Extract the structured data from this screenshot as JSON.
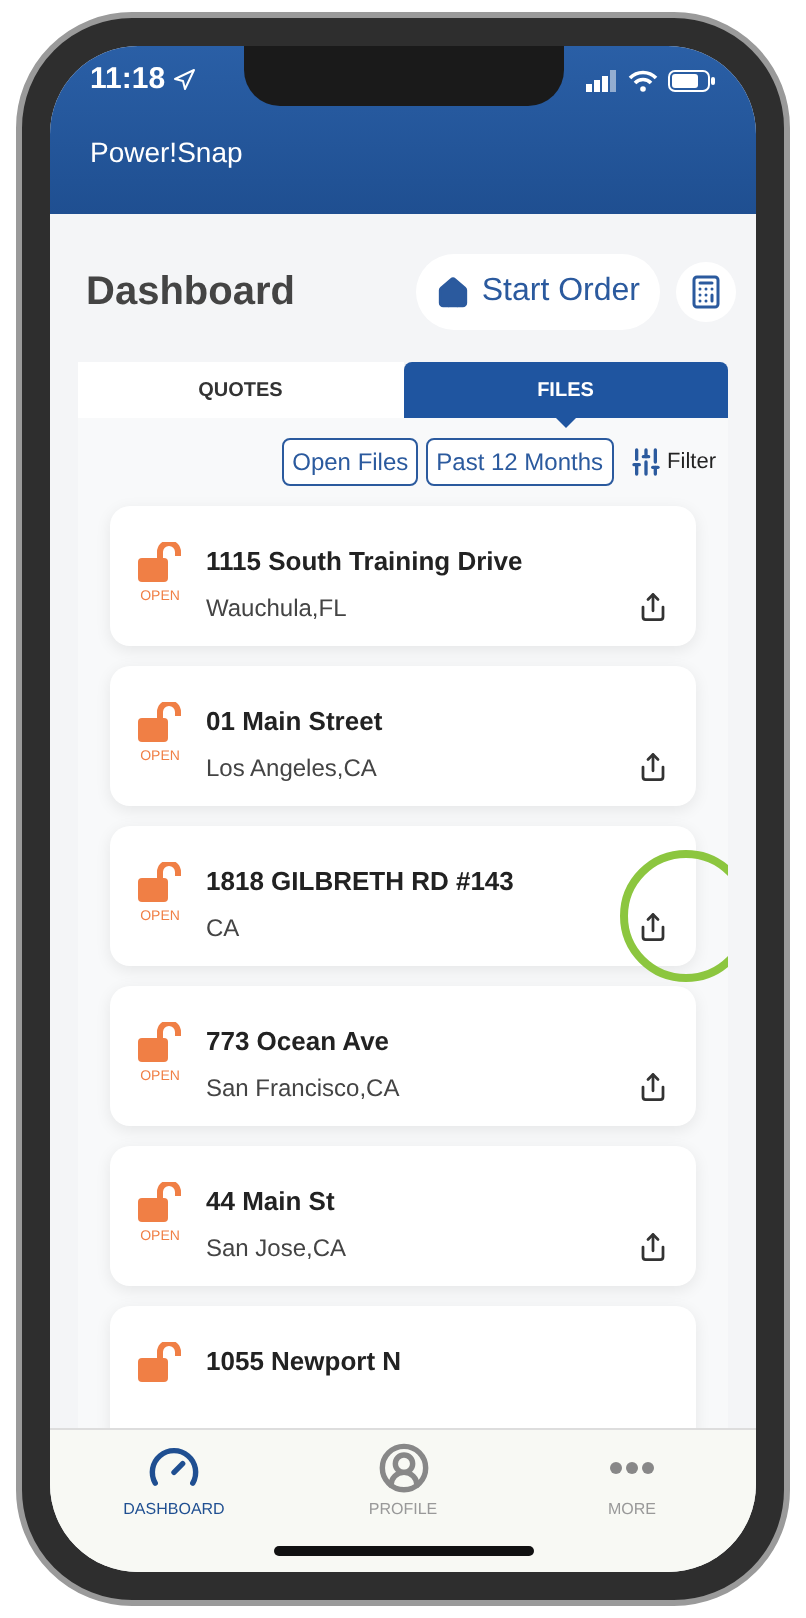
{
  "status_bar": {
    "time": "11:18"
  },
  "app_bar": {
    "title": "Power!Snap"
  },
  "page": {
    "title": "Dashboard",
    "start_order": "Start Order"
  },
  "tabs": [
    {
      "label": "QUOTES",
      "selected": false
    },
    {
      "label": "FILES",
      "selected": true
    }
  ],
  "filters": {
    "chips": [
      "Open Files",
      "Past 12 Months"
    ],
    "filter_button": "Filter"
  },
  "files": [
    {
      "status": "OPEN",
      "title": "1115 South Training Drive",
      "location": "Wauchula,FL",
      "highlighted": false
    },
    {
      "status": "OPEN",
      "title": "01 Main Street",
      "location": "Los Angeles,CA",
      "highlighted": false
    },
    {
      "status": "OPEN",
      "title": "1818 GILBRETH RD #143",
      "location": "CA",
      "highlighted": true
    },
    {
      "status": "OPEN",
      "title": "773 Ocean Ave",
      "location": "San Francisco,CA",
      "highlighted": false
    },
    {
      "status": "OPEN",
      "title": "44 Main St",
      "location": "San Jose,CA",
      "highlighted": false
    },
    {
      "title": "1055 Newport N",
      "highlighted": false
    }
  ],
  "bottom_nav": [
    {
      "kind": "dashboard",
      "label": "DASHBOARD",
      "selected": true
    },
    {
      "kind": "profile",
      "label": "PROFILE",
      "selected": false
    },
    {
      "kind": "more",
      "label": "MORE",
      "selected": false
    }
  ]
}
